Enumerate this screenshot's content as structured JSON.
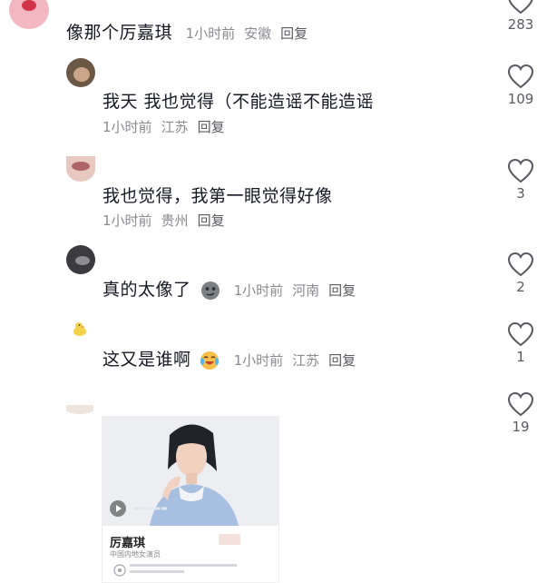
{
  "comments": [
    {
      "text": "像那个厉嘉琪",
      "time": "1小时前",
      "location": "安徽",
      "reply": "回复",
      "likes": "283"
    },
    {
      "text": "我天 我也觉得（不能造谣不能造谣",
      "time": "1小时前",
      "location": "江苏",
      "reply": "回复",
      "likes": "109"
    },
    {
      "text": "我也觉得，我第一眼觉得好像",
      "time": "1小时前",
      "location": "贵州",
      "reply": "回复",
      "likes": "3"
    },
    {
      "text": "真的太像了",
      "time": "1小时前",
      "location": "河南",
      "reply": "回复",
      "likes": "2"
    },
    {
      "text": "这又是谁啊",
      "time": "1小时前",
      "location": "江苏",
      "reply": "回复",
      "likes": "1"
    },
    {
      "likes": "19",
      "card": {
        "name": "厉嘉琪",
        "subtitle": "中国内地女演员"
      }
    }
  ],
  "colors": {
    "text": "#161823",
    "meta": "#8a8b91",
    "reply": "#5a5b62"
  },
  "icons": [
    "heart-icon",
    "smirk-emoji",
    "crying-laugh-emoji",
    "play-icon"
  ]
}
